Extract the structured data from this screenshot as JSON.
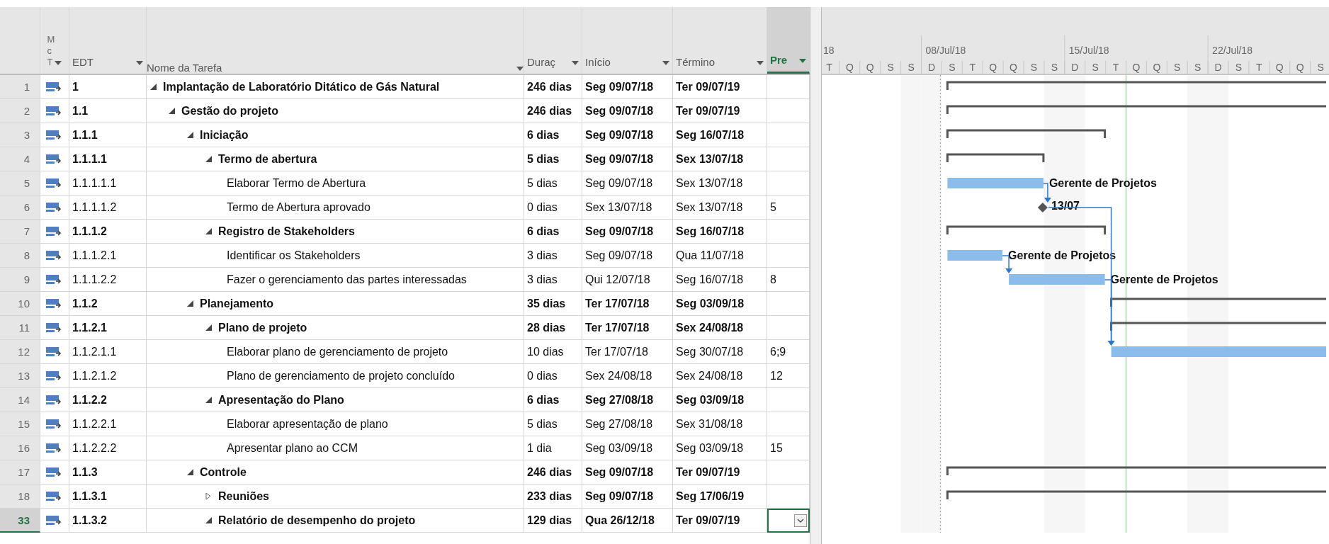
{
  "columns": [
    {
      "label_lines": [
        "M",
        "c",
        "T"
      ],
      "selected": false
    },
    {
      "label": "EDT",
      "selected": false
    },
    {
      "label": "Nome da Tarefa",
      "selected": false
    },
    {
      "label": "Duraç",
      "selected": false
    },
    {
      "label": "Início",
      "selected": false
    },
    {
      "label": "Término",
      "selected": false
    },
    {
      "label": "Pre",
      "selected": true
    }
  ],
  "timescale": {
    "weeks": [
      "18",
      "08/Jul/18",
      "15/Jul/18",
      "22/Jul/18"
    ],
    "days": [
      "T",
      "Q",
      "Q",
      "S",
      "S",
      "D",
      "S",
      "T",
      "Q",
      "Q",
      "S",
      "S",
      "D",
      "S",
      "T",
      "Q",
      "Q",
      "S",
      "S",
      "D",
      "S",
      "T",
      "Q",
      "Q",
      "S"
    ]
  },
  "rows": [
    {
      "num": "1",
      "edt": "1",
      "name": "Implantação de Laboratório Ditático de Gás Natural",
      "duration": "246 dias",
      "start": "Seg 09/07/18",
      "finish": "Ter 09/07/19",
      "kind": "summary",
      "expanded": true,
      "selected": false,
      "children": [
        {
          "num": "2",
          "edt": "1.1",
          "name": "Gestão do projeto",
          "duration": "246 dias",
          "start": "Seg 09/07/18",
          "finish": "Ter 09/07/19",
          "kind": "summary",
          "expanded": true,
          "selected": false,
          "children": [
            {
              "num": "3",
              "edt": "1.1.1",
              "name": "Iniciação",
              "duration": "6 dias",
              "start": "Seg 09/07/18",
              "finish": "Seg 16/07/18",
              "kind": "summary",
              "expanded": true,
              "selected": false,
              "children": [
                {
                  "num": "4",
                  "edt": "1.1.1.1",
                  "name": "Termo de abertura",
                  "duration": "5 dias",
                  "start": "Seg 09/07/18",
                  "finish": "Sex 13/07/18",
                  "kind": "summary",
                  "expanded": true,
                  "selected": false,
                  "children": [
                    {
                      "num": "5",
                      "edt": "1.1.1.1.1",
                      "name": "Elaborar Termo de Abertura",
                      "duration": "5 dias",
                      "start": "Seg 09/07/18",
                      "finish": "Sex 13/07/18",
                      "kind": "task",
                      "selected": false,
                      "bar_label": "Gerente de Projetos"
                    },
                    {
                      "num": "6",
                      "edt": "1.1.1.1.2",
                      "name": "Termo de Abertura aprovado",
                      "duration": "0 dias",
                      "start": "Sex 13/07/18",
                      "finish": "Sex 13/07/18",
                      "predecessors": "5",
                      "kind": "milestone",
                      "selected": false,
                      "bar_label": "13/07"
                    }
                  ]
                },
                {
                  "num": "7",
                  "edt": "1.1.1.2",
                  "name": "Registro de Stakeholders",
                  "duration": "6 dias",
                  "start": "Seg 09/07/18",
                  "finish": "Seg 16/07/18",
                  "kind": "summary",
                  "expanded": true,
                  "selected": false,
                  "children": [
                    {
                      "num": "8",
                      "edt": "1.1.1.2.1",
                      "name": "Identificar os Stakeholders",
                      "duration": "3 dias",
                      "start": "Seg 09/07/18",
                      "finish": "Qua 11/07/18",
                      "kind": "task",
                      "selected": false,
                      "bar_label": "Gerente de Projetos"
                    },
                    {
                      "num": "9",
                      "edt": "1.1.1.2.2",
                      "name": "Fazer o gerenciamento das partes interessadas",
                      "duration": "3 dias",
                      "start": "Qui 12/07/18",
                      "finish": "Seg 16/07/18",
                      "predecessors": "8",
                      "kind": "task",
                      "selected": false,
                      "bar_label": "Gerente de Projetos"
                    }
                  ]
                }
              ]
            },
            {
              "num": "10",
              "edt": "1.1.2",
              "name": "Planejamento",
              "duration": "35 dias",
              "start": "Ter 17/07/18",
              "finish": "Seg 03/09/18",
              "kind": "summary",
              "expanded": true,
              "selected": false,
              "children": [
                {
                  "num": "11",
                  "edt": "1.1.2.1",
                  "name": "Plano de projeto",
                  "duration": "28 dias",
                  "start": "Ter 17/07/18",
                  "finish": "Sex 24/08/18",
                  "kind": "summary",
                  "expanded": true,
                  "selected": false,
                  "children": [
                    {
                      "num": "12",
                      "edt": "1.1.2.1.1",
                      "name": "Elaborar plano de gerenciamento de projeto",
                      "duration": "10 dias",
                      "start": "Ter 17/07/18",
                      "finish": "Seg 30/07/18",
                      "predecessors": "6;9",
                      "kind": "task",
                      "selected": false
                    },
                    {
                      "num": "13",
                      "edt": "1.1.2.1.2",
                      "name": "Plano de gerenciamento de projeto concluído",
                      "duration": "0 dias",
                      "start": "Sex 24/08/18",
                      "finish": "Sex 24/08/18",
                      "predecessors": "12",
                      "kind": "milestone",
                      "selected": false
                    }
                  ]
                },
                {
                  "num": "14",
                  "edt": "1.1.2.2",
                  "name": "Apresentação do Plano",
                  "duration": "6 dias",
                  "start": "Seg 27/08/18",
                  "finish": "Seg 03/09/18",
                  "kind": "summary",
                  "expanded": true,
                  "selected": false,
                  "children": [
                    {
                      "num": "15",
                      "edt": "1.1.2.2.1",
                      "name": "Elaborar apresentação de plano",
                      "duration": "5 dias",
                      "start": "Seg 27/08/18",
                      "finish": "Sex 31/08/18",
                      "kind": "task",
                      "selected": false
                    },
                    {
                      "num": "16",
                      "edt": "1.1.2.2.2",
                      "name": "Apresentar plano ao CCM",
                      "duration": "1 dia",
                      "start": "Seg 03/09/18",
                      "finish": "Seg 03/09/18",
                      "predecessors": "15",
                      "kind": "task",
                      "selected": false
                    }
                  ]
                }
              ]
            },
            {
              "num": "17",
              "edt": "1.1.3",
              "name": "Controle",
              "duration": "246 dias",
              "start": "Seg 09/07/18",
              "finish": "Ter 09/07/19",
              "kind": "summary",
              "expanded": true,
              "selected": false,
              "children": [
                {
                  "num": "18",
                  "edt": "1.1.3.1",
                  "name": "Reuniões",
                  "duration": "233 dias",
                  "start": "Seg 09/07/18",
                  "finish": "Seg 17/06/19",
                  "kind": "summary",
                  "expanded": false,
                  "selected": false
                },
                {
                  "num": "33",
                  "edt": "1.1.3.2",
                  "name": "Relatório de desempenho do projeto",
                  "duration": "129 dias",
                  "start": "Qua 26/12/18",
                  "finish": "Ter 09/07/19",
                  "kind": "summary",
                  "expanded": true,
                  "selected": true
                }
              ]
            }
          ]
        }
      ]
    }
  ]
}
